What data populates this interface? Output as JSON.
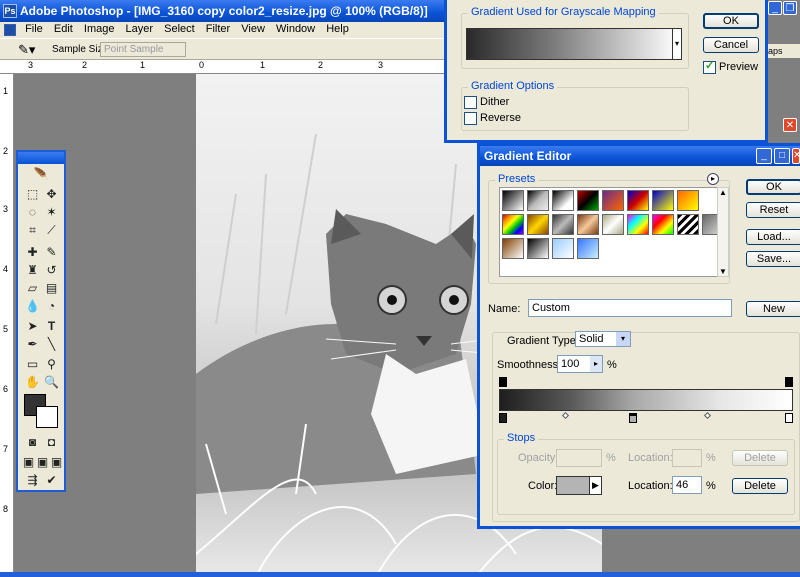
{
  "app": {
    "title": "Adobe Photoshop - [IMG_3160 copy color2_resize.jpg @ 100% (RGB/8)]",
    "menu": [
      "File",
      "Edit",
      "Image",
      "Layer",
      "Select",
      "Filter",
      "View",
      "Window",
      "Help"
    ],
    "options": {
      "sample_size_label": "Sample Size:",
      "sample_size_value": "Point Sample"
    },
    "ruler_h": [
      "3",
      "2",
      "1",
      "0",
      "1",
      "2",
      "3"
    ],
    "ruler_v": [
      "1",
      "2",
      "3",
      "4",
      "5",
      "6",
      "7",
      "8"
    ]
  },
  "gradient_map_dialog": {
    "gradient_group_label": "Gradient Used for Grayscale Mapping",
    "options_group_label": "Gradient Options",
    "dither_label": "Dither",
    "reverse_label": "Reverse",
    "preview_label": "Preview",
    "ok_label": "OK",
    "cancel_label": "Cancel",
    "dither_checked": false,
    "reverse_checked": false,
    "preview_checked": true,
    "behind_tab": "aps"
  },
  "gradient_editor": {
    "title": "Gradient Editor",
    "presets_label": "Presets",
    "ok_label": "OK",
    "reset_label": "Reset",
    "load_label": "Load...",
    "save_label": "Save...",
    "name_label": "Name:",
    "name_value": "Custom",
    "new_label": "New",
    "gradient_type_label": "Gradient Type:",
    "gradient_type_value": "Solid",
    "smoothness_label": "Smoothness:",
    "smoothness_value": "100",
    "smoothness_unit": "%",
    "stops_label": "Stops",
    "opacity_label": "Opacity:",
    "opacity_unit": "%",
    "location_label": "Location:",
    "location_unit": "%",
    "delete_label": "Delete",
    "color_label": "Color:",
    "color_location_value": "46",
    "color_location_unit": "%",
    "color_delete_label": "Delete",
    "colors": {
      "title_blue": "#0a53d6",
      "legend_blue": "#0046d5",
      "panel": "#ece9d8"
    }
  }
}
